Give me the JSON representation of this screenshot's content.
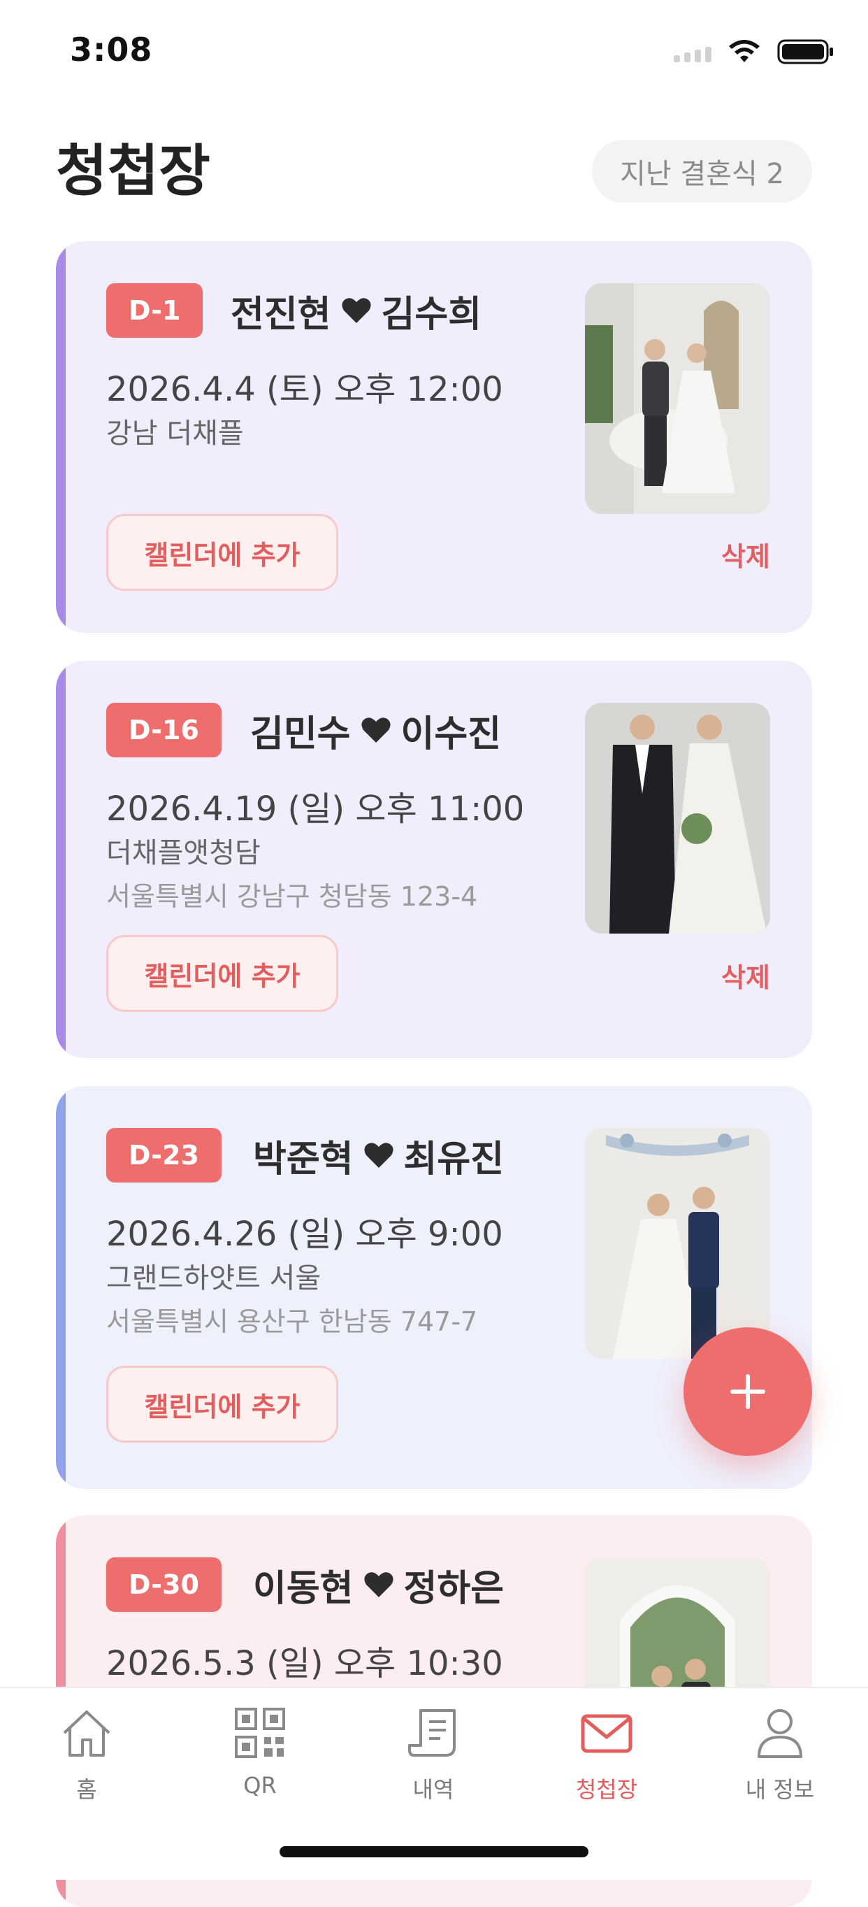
{
  "status_bar": {
    "time": "3:08"
  },
  "header": {
    "title": "청첩장",
    "past_button": "지난 결혼식 2"
  },
  "cards": [
    {
      "dday": "D-1",
      "groom": "전진현",
      "bride": "김수희",
      "date": "2026.4.4 (토) 오후 12:00",
      "venue": "강남 더채플",
      "address": "",
      "calendar_label": "캘린더에 추가",
      "delete_label": "삭제",
      "accent_color": "#a98ae8",
      "bg_color": "#f1edfc"
    },
    {
      "dday": "D-16",
      "groom": "김민수",
      "bride": "이수진",
      "date": "2026.4.19 (일) 오후 11:00",
      "venue": "더채플앳청담",
      "address": "서울특별시 강남구 청담동 123-4",
      "calendar_label": "캘린더에 추가",
      "delete_label": "삭제",
      "accent_color": "#a98ae8",
      "bg_color": "#f1edfc"
    },
    {
      "dday": "D-23",
      "groom": "박준혁",
      "bride": "최유진",
      "date": "2026.4.26 (일) 오후 9:00",
      "venue": "그랜드하얏트 서울",
      "address": "서울특별시 용산구 한남동 747-7",
      "calendar_label": "캘린더에 추가",
      "accent_color": "#8fa2ea",
      "bg_color": "#eef0fc"
    },
    {
      "dday": "D-30",
      "groom": "이동현",
      "bride": "정하은",
      "date": "2026.5.3 (일) 오후 10:30",
      "accent_color": "#ef8fa0",
      "bg_color": "#fcedf0"
    }
  ],
  "fab": {
    "icon": "plus-icon"
  },
  "nav": [
    {
      "label": "홈",
      "icon": "home-icon"
    },
    {
      "label": "QR",
      "icon": "qr-icon"
    },
    {
      "label": "내역",
      "icon": "receipt-icon"
    },
    {
      "label": "청첩장",
      "icon": "envelope-icon",
      "active": true
    },
    {
      "label": "내 정보",
      "icon": "person-icon"
    }
  ],
  "colors": {
    "accent": "#ee6e6e",
    "nav_inactive": "#7a7a7a"
  }
}
